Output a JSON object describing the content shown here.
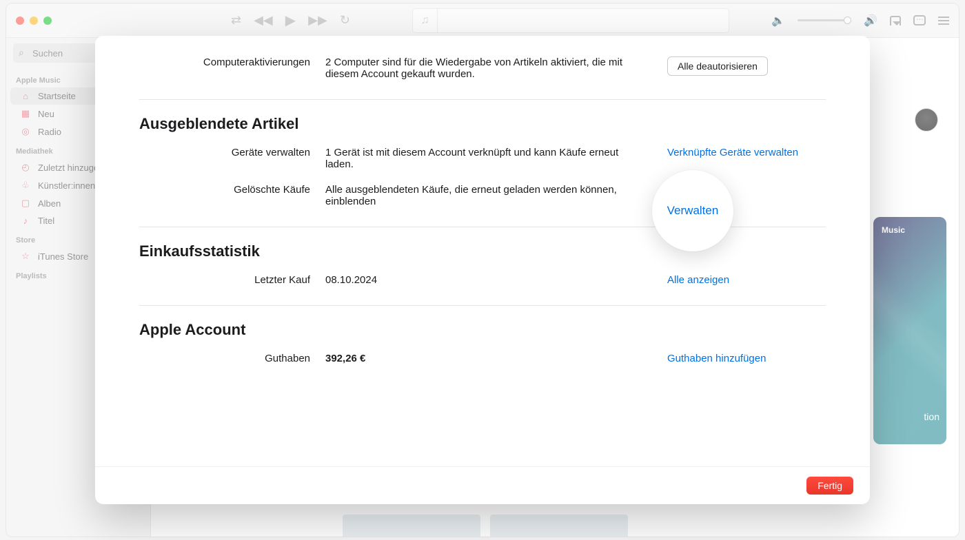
{
  "search_placeholder": "Suchen",
  "sidebar": {
    "sec_apple_music": "Apple Music",
    "home": "Startseite",
    "new": "Neu",
    "radio": "Radio",
    "sec_library": "Mediathek",
    "recent": "Zuletzt hinzugefügt",
    "artists": "Künstler:innen",
    "albums": "Alben",
    "titles": "Titel",
    "sec_store": "Store",
    "itunes": "iTunes Store",
    "sec_playlists": "Playlists"
  },
  "promo": {
    "badge": "Music",
    "cta": "tion"
  },
  "modal": {
    "comp_act_label": "Computeraktivierungen",
    "comp_act_value": "2 Computer sind für die Wiedergabe von Artikeln aktiviert, die mit diesem Account gekauft wurden.",
    "comp_act_action": "Alle deautorisieren",
    "sec_hidden": "Ausgeblendete Artikel",
    "devices_label": "Geräte verwalten",
    "devices_value": "1 Gerät ist mit diesem Account verknüpft und kann Käufe erneut laden.",
    "devices_action": "Verknüpfte Geräte verwalten",
    "deleted_label": "Gelöschte Käufe",
    "deleted_value": "Alle ausgeblendeten Käufe, die erneut geladen werden können, einblenden",
    "deleted_action": "Verwalten",
    "sec_stats": "Einkaufsstatistik",
    "last_purchase_label": "Letzter Kauf",
    "last_purchase_value": "08.10.2024",
    "last_purchase_action": "Alle anzeigen",
    "sec_account": "Apple Account",
    "balance_label": "Guthaben",
    "balance_value": "392,26 €",
    "balance_action": "Guthaben hinzufügen",
    "done": "Fertig"
  },
  "spotlight": "Verwalten"
}
